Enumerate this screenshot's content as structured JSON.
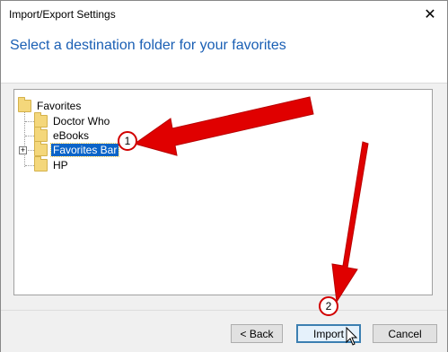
{
  "window": {
    "title": "Import/Export Settings",
    "close_glyph": "✕"
  },
  "header": {
    "heading": "Select a destination folder for your favorites"
  },
  "tree": {
    "root": {
      "label": "Favorites",
      "icon": "folder-icon"
    },
    "children": [
      {
        "label": "Doctor Who",
        "icon": "folder-icon"
      },
      {
        "label": "eBooks",
        "icon": "folder-icon"
      },
      {
        "label": "Favorites Bar",
        "icon": "folder-icon",
        "selected": true,
        "expander": "+"
      },
      {
        "label": "HP",
        "icon": "folder-icon"
      }
    ]
  },
  "footer": {
    "back_label": "< Back",
    "import_label": "Import",
    "cancel_label": "Cancel"
  },
  "annotations": {
    "badge1": "1",
    "badge2": "2",
    "arrow_color": "#e00000"
  }
}
